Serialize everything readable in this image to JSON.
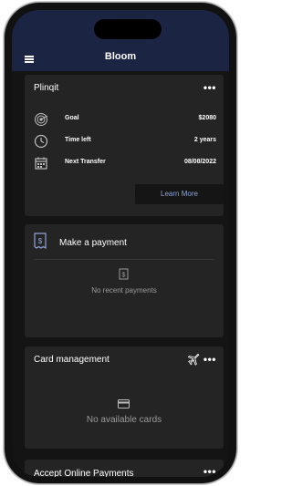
{
  "app": {
    "title": "Bloom"
  },
  "goal_card": {
    "title": "Plinqit",
    "rows": [
      {
        "label": "Goal",
        "value": "$2080",
        "icon": "target-icon"
      },
      {
        "label": "Time left",
        "value": "2 years",
        "icon": "clock-icon"
      },
      {
        "label": "Next Transfer",
        "value": "08/08/2022",
        "icon": "calendar-icon"
      }
    ],
    "button_label": "Learn More"
  },
  "payment_card": {
    "title": "Make a payment",
    "empty_text": "No recent payments"
  },
  "card_management": {
    "title": "Card management",
    "empty_text": "No available cards"
  },
  "online_payments": {
    "title": "Accept Online Payments"
  },
  "more_glyph": "•••",
  "colors": {
    "header": "#1c2444",
    "card": "#242424",
    "background": "#141414",
    "accent": "#8ea3d8"
  }
}
